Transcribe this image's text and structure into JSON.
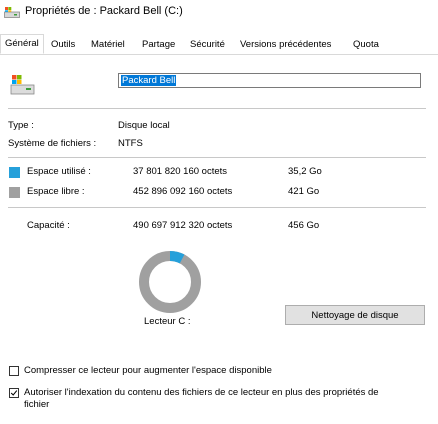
{
  "window": {
    "title": "Propriétés de : Packard Bell (C:)"
  },
  "tabs": [
    {
      "label": "Général"
    },
    {
      "label": "Outils"
    },
    {
      "label": "Matériel"
    },
    {
      "label": "Partage"
    },
    {
      "label": "Sécurité"
    },
    {
      "label": "Versions précédentes"
    },
    {
      "label": "Quota"
    }
  ],
  "drive": {
    "name": "Packard Bell"
  },
  "info": {
    "type_label": "Type :",
    "type_value": "Disque local",
    "fs_label": "Système de fichiers :",
    "fs_value": "NTFS"
  },
  "usage": {
    "used_label": "Espace utilisé :",
    "used_bytes": "37 801 820 160 octets",
    "used_size": "35,2 Go",
    "free_label": "Espace libre :",
    "free_bytes": "452 896 092 160 octets",
    "free_size": "421 Go",
    "capacity_label": "Capacité :",
    "capacity_bytes": "490 697 912 320 octets",
    "capacity_size": "456 Go",
    "used_fraction": 0.077,
    "used_color": "#26a0da",
    "free_color": "#a0a0a0"
  },
  "drive_label": "Lecteur C :",
  "cleanup_button": "Nettoyage de disque",
  "options": {
    "compress_label": "Compresser ce lecteur pour augmenter l'espace disponible",
    "compress_checked": false,
    "index_label_line1": "Autoriser l'indexation du contenu des fichiers de ce lecteur en plus des propriétés de",
    "index_label_line2": "fichier",
    "index_checked": true
  }
}
